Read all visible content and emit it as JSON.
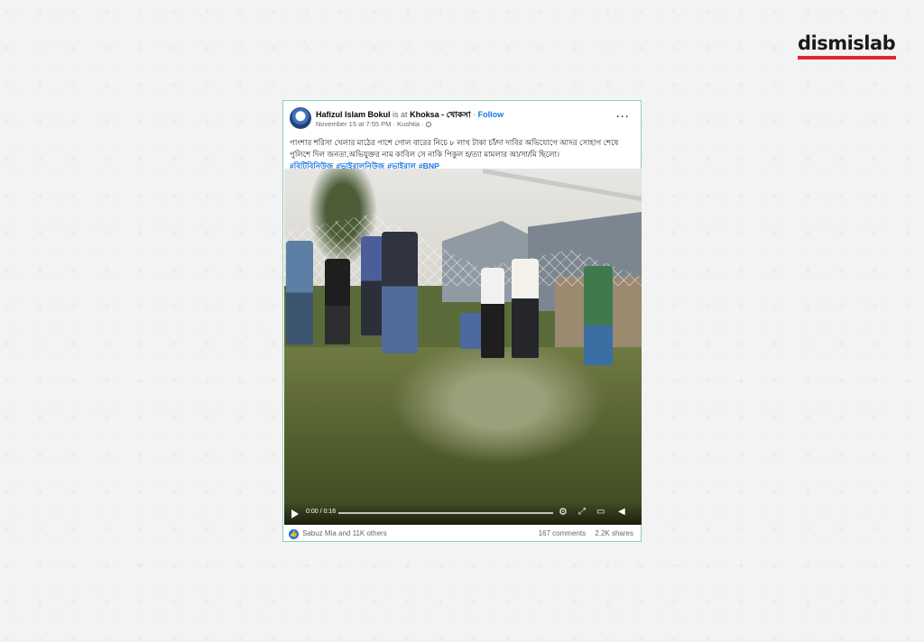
{
  "brand": {
    "name": "dismislab",
    "accent": "#e0252b"
  },
  "post": {
    "author": "Hafizul Islam Bokul",
    "is_at": "is at",
    "place": "Khoksa - খোকসা",
    "separator": "·",
    "follow": "Follow",
    "meta": "November 15 at 7:55 PM · Kushtia ·",
    "more": "···",
    "caption": "পাংশার শরিসা খেলার মাঠের পাশে গোল বারের নিচে ৮ লাখ টাকা চাঁ/দা দাবির অভিযোগে আদর সোহাগ শেষে পুলিশে দিল জনতা,অভিযুক্তর নাম কাবিল সে নাকি পিকুল হ/ত্যা মামলার আ/সা/মি ছিলো।",
    "hashtags": [
      "#বিটিবিনিউজ",
      "#ভাইরালনিউজ",
      "#ভাইরাল",
      "#BNP"
    ],
    "video": {
      "time": "0:00 / 0:16",
      "icons": [
        "play-icon",
        "settings-icon",
        "fullscreen-icon",
        "pip-icon",
        "volume-icon"
      ]
    },
    "reactions": "Sabuz Mia and 11K others",
    "comments": "167 comments",
    "shares": "2.2K shares"
  }
}
